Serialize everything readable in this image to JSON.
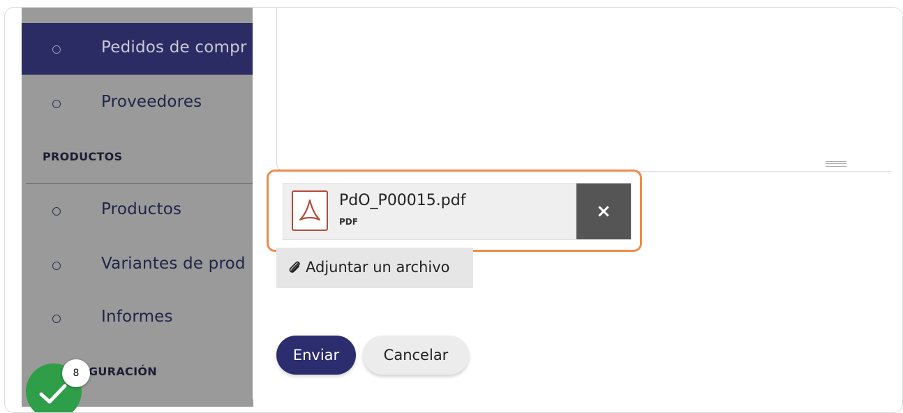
{
  "sidebar": {
    "items_top": [
      {
        "label": "Pedidos de compr",
        "active": true
      },
      {
        "label": "Proveedores",
        "active": false
      }
    ],
    "section_products": "PRODUCTOS",
    "items_products": [
      {
        "label": "Productos"
      },
      {
        "label": "Variantes de prod"
      },
      {
        "label": "Informes"
      }
    ],
    "section_config": "GURACIÓN"
  },
  "attachment": {
    "file_name": "PdO_P00015.pdf",
    "file_type": "PDF",
    "remove_label": "×"
  },
  "attach_button": {
    "label": "Adjuntar un archivo"
  },
  "actions": {
    "send": "Enviar",
    "cancel": "Cancelar"
  },
  "badge": {
    "count": "8"
  },
  "icons": {
    "bullet": "circle-bullet-icon",
    "pdf": "pdf-file-icon",
    "clip": "paperclip-icon",
    "check": "check-icon"
  },
  "colors": {
    "active_item": "#2a2c63",
    "primary_button": "#2b2d6e",
    "highlight": "#f08a4b",
    "check": "#2f9e49"
  }
}
